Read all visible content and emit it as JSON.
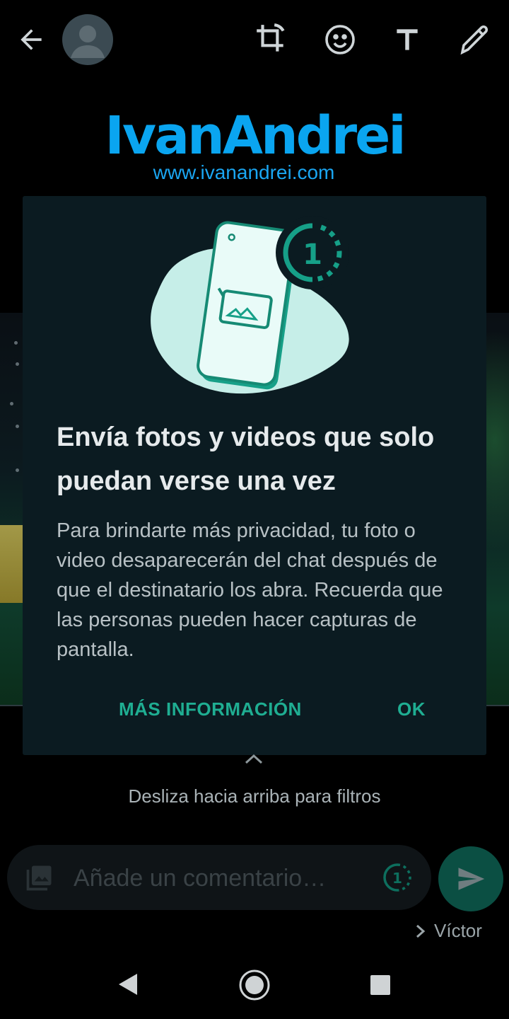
{
  "watermark": {
    "title": "IvanAndrei",
    "url": "www.ivanandrei.com"
  },
  "topbar": {
    "icons": [
      "back-arrow-icon",
      "avatar",
      "crop-rotate-icon",
      "emoji-icon",
      "text-icon",
      "pencil-icon"
    ]
  },
  "dialog": {
    "title": "Envía fotos y videos que solo puedan verse una vez",
    "body": "Para brindarte más privacidad, tu foto o video desaparecerán del chat después de que el destinatario los abra. Recuerda que las personas pueden hacer capturas de pantalla.",
    "more_info_label": "MÁS INFORMACIÓN",
    "ok_label": "OK",
    "illustration_badge": "1"
  },
  "swipe_hint": "Desliza hacia arriba para filtros",
  "comment": {
    "placeholder": "Añade un comentario…",
    "view_once_badge": "1"
  },
  "recipient": {
    "name": "Víctor"
  },
  "colors": {
    "accent": "#1fae92",
    "dialog_bg": "#0b1b21",
    "watermark": "#0aa5f0"
  }
}
